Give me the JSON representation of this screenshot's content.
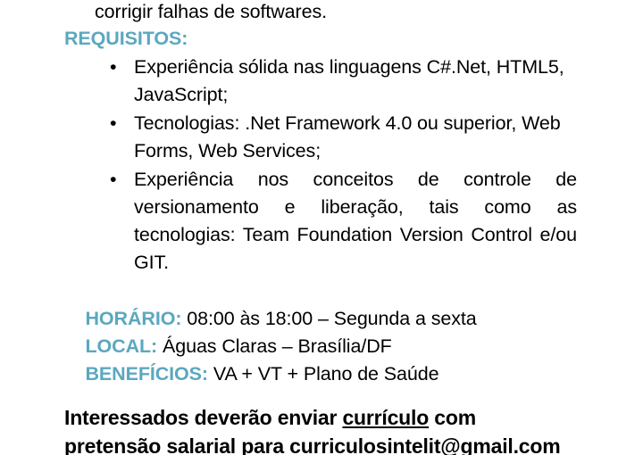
{
  "document": {
    "background_color": "#ffffff",
    "accent_color": "#5BA8BF",
    "body_color": "#000000",
    "continuation_line": "corrigir falhas de softwares."
  },
  "sections": {
    "requisitos": {
      "heading": "REQUISITOS:",
      "bullet_glyph": "•",
      "items": [
        "Experiência sólida nas linguagens C#.Net,  HTML5, JavaScript;",
        "Tecnologias: .Net Framework 4.0 ou superior, Web Forms, Web Services;",
        "Experiência nos conceitos de controle de versionamento e liberação, tais como as tecnologias: Team Foundation Version Control e/ou GIT."
      ]
    }
  },
  "details": [
    {
      "label": "HORÁRIO:",
      "value": " 08:00 às 18:00 – Segunda a sexta"
    },
    {
      "label": "LOCAL:",
      "value": " Águas Claras – Brasília/DF"
    },
    {
      "label": "BENEFÍCIOS:",
      "value": " VA + VT + Plano de Saúde"
    }
  ],
  "closing": {
    "part1": "Interessados deverão enviar ",
    "underlined": "currículo",
    "part2": " com",
    "line2": "pretensão salarial para curriculosintelit@gmail.com"
  }
}
